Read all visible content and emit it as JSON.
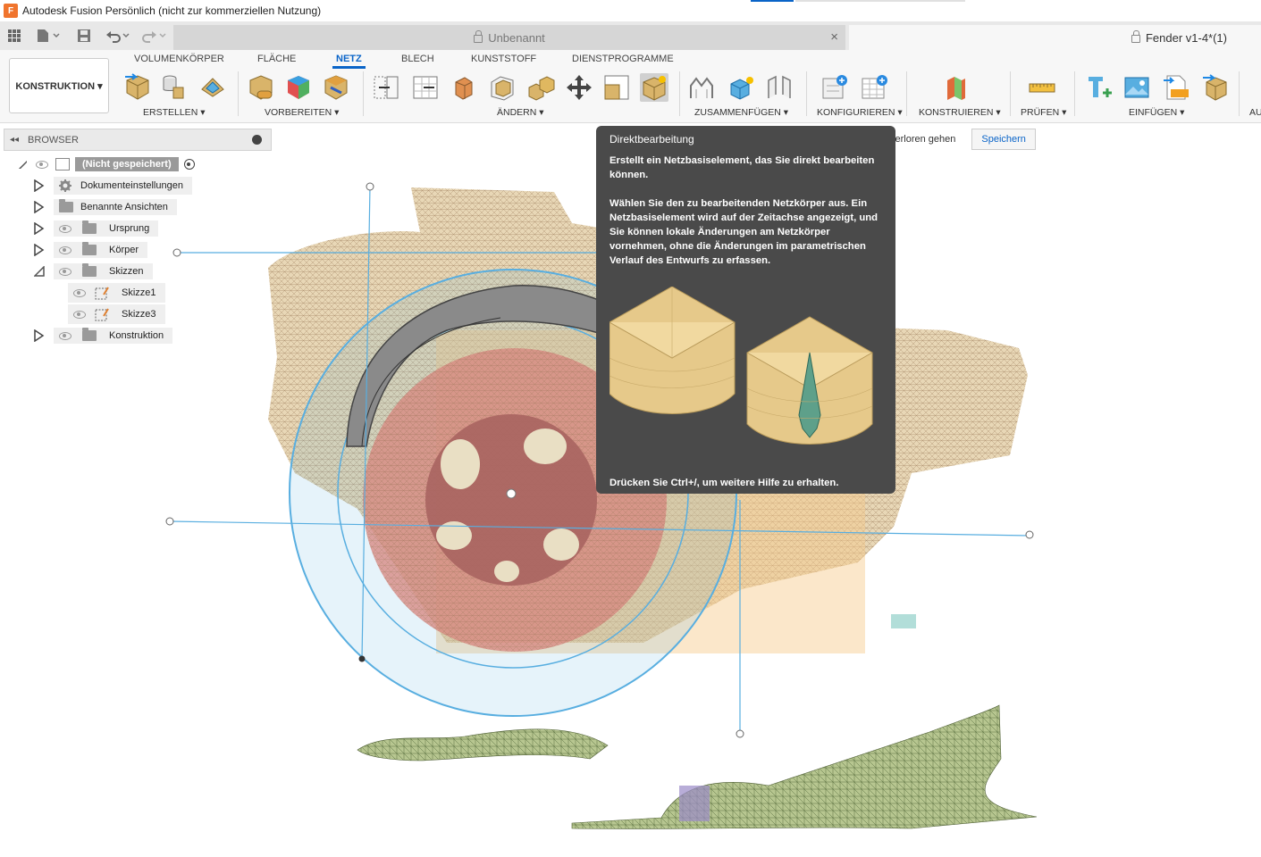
{
  "window": {
    "title": "Autodesk Fusion Persönlich (nicht zur kommerziellen Nutzung)",
    "logo_letter": "F"
  },
  "tabs": {
    "inactive_label": "Unbenannt",
    "active_label": "Fender v1-4*(1)",
    "close_glyph": "×"
  },
  "ribbon": {
    "workspace_label": "KONSTRUKTION ▾",
    "tabs": [
      "VOLUMENKÖRPER",
      "FLÄCHE",
      "NETZ",
      "BLECH",
      "KUNSTSTOFF",
      "DIENSTPROGRAMME"
    ],
    "active_tab": "NETZ",
    "groups": [
      "ERSTELLEN ▾",
      "VORBEREITEN ▾",
      "ÄNDERN ▾",
      "ZUSAMMENFÜGEN ▾",
      "KONFIGURIEREN ▾",
      "KONSTRUIEREN ▾",
      "PRÜFEN ▾",
      "EINFÜGEN ▾",
      "AU"
    ]
  },
  "browser": {
    "header": "BROWSER",
    "root": "(Nicht gespeichert)",
    "items": [
      {
        "label": "Dokumenteinstellungen"
      },
      {
        "label": "Benannte Ansichten"
      },
      {
        "label": "Ursprung"
      },
      {
        "label": "Körper"
      },
      {
        "label": "Skizzen"
      },
      {
        "label": "Skizze1"
      },
      {
        "label": "Skizze3"
      },
      {
        "label": "Konstruktion"
      }
    ]
  },
  "notice": {
    "text": "verloren gehen",
    "save_label": "Speichern"
  },
  "tooltip": {
    "title": "Direktbearbeitung",
    "para1": "Erstellt ein Netzbasiselement, das Sie direkt bearbeiten können.",
    "para2": "Wählen Sie den zu bearbeitenden Netzkörper aus. Ein Netzbasiselement wird auf der Zeitachse angezeigt, und Sie können lokale Änderungen am Netzkörper vornehmen, ohne die Änderungen im parametrischen Verlauf des Entwurfs zu erfassen.",
    "footer": "Drücken Sie Ctrl+/, um weitere Hilfe zu erhalten."
  },
  "colors": {
    "accent": "#0a64c8",
    "tool_gold": "#d9b46a",
    "sketch_blue": "#58aee0",
    "tooltip_bg": "#4a4a4a"
  }
}
